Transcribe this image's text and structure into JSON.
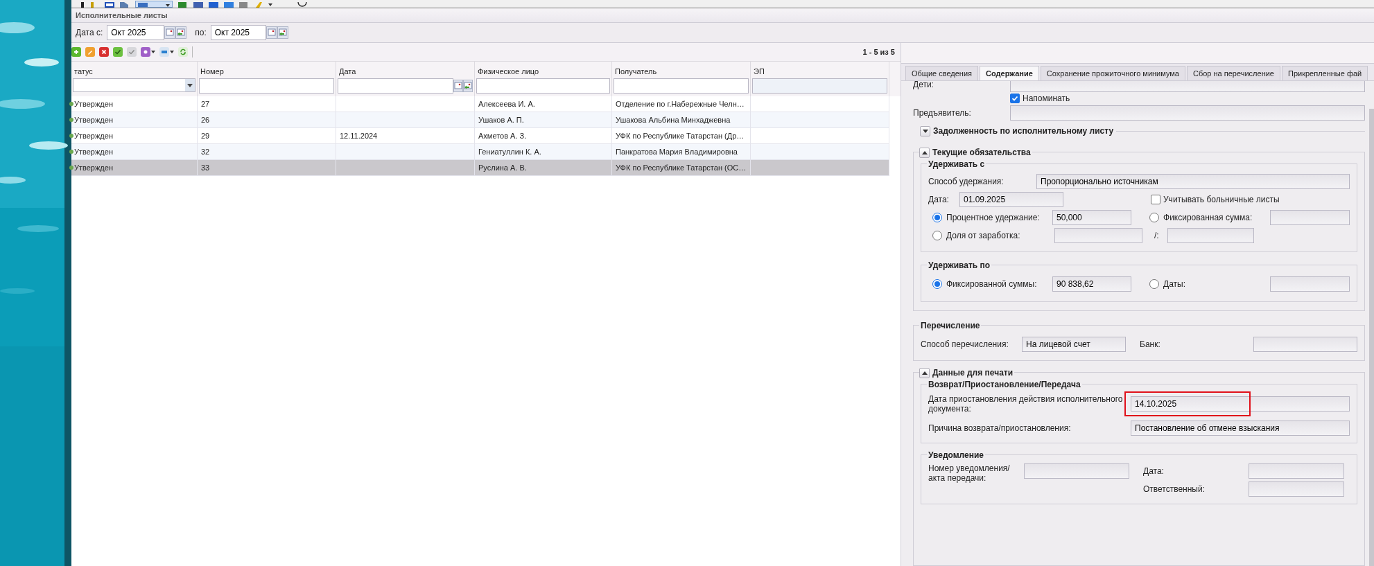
{
  "list_title": "Исполнительные листы",
  "date_filter": {
    "from_label": "Дата с:",
    "from_value": "Окт 2025",
    "to_label": "по:",
    "to_value": "Окт 2025"
  },
  "pager": "1 - 5 из 5",
  "table": {
    "columns": [
      "татус",
      "Номер",
      "Дата",
      "Физическое лицо",
      "Получатель",
      "ЭП"
    ],
    "rows": [
      {
        "cells": [
          "Утвержден",
          "27",
          "",
          "Алексеева И. А.",
          "Отделение по г.Набережные Челн…",
          ""
        ],
        "selected": false
      },
      {
        "cells": [
          "Утвержден",
          "26",
          "",
          "Ушаков А. П.",
          "Ушакова Альбина Минхаджевна",
          ""
        ],
        "selected": false
      },
      {
        "cells": [
          "Утвержден",
          "29",
          "12.11.2024",
          "Ахметов А. З.",
          "УФК по Республике Татарстан (Др…",
          ""
        ],
        "selected": false
      },
      {
        "cells": [
          "Утвержден",
          "32",
          "",
          "Гениатуллин К. А.",
          "Панкратова Мария Владимировна",
          ""
        ],
        "selected": false
      },
      {
        "cells": [
          "Утвержден",
          "33",
          "",
          "Руслина А. В.",
          "УФК по Республике Татарстан (ОС…",
          ""
        ],
        "selected": true
      }
    ]
  },
  "tabs": [
    {
      "label": "Общие сведения",
      "selected": false
    },
    {
      "label": "Содержание",
      "selected": true
    },
    {
      "label": "Сохранение прожиточного минимума",
      "selected": false
    },
    {
      "label": "Сбор на перечисление",
      "selected": false
    },
    {
      "label": "Прикрепленные фай",
      "selected": false
    }
  ],
  "form": {
    "children_label": "Дети:",
    "remind": {
      "label": "Напоминать",
      "checked": true
    },
    "claimant_label": "Предъявитель:",
    "debt_section": {
      "title": "Задолженность по исполнительному листу",
      "expanded": false
    },
    "current_section": {
      "title": "Текущие обязательства",
      "expanded": true,
      "hold_from": {
        "title": "Удерживать с",
        "method_label": "Способ удержания:",
        "method_value": "Пропорционально источникам",
        "date_label": "Дата:",
        "date_value": "01.09.2025",
        "sick_leave": {
          "label": "Учитывать больничные листы",
          "checked": false
        },
        "options": [
          {
            "label": "Процентное удержание:",
            "value": "50,000",
            "selected": true
          },
          {
            "label": "Фиксированная сумма:",
            "selected": false
          },
          {
            "label": "Доля от заработка:",
            "selected": false
          }
        ],
        "fraction_separator": "/:"
      },
      "hold_until": {
        "title": "Удерживать по",
        "options": [
          {
            "label": "Фиксированной суммы:",
            "value": "90 838,62",
            "selected": true
          },
          {
            "label": "Даты:",
            "selected": false
          }
        ]
      }
    },
    "transfer": {
      "title": "Перечисление",
      "method_label": "Способ перечисления:",
      "method_value": "На лицевой счет",
      "bank_label": "Банк:"
    },
    "print_section": {
      "title": "Данные для печати",
      "expanded": true,
      "return": {
        "title": "Возврат/Приостановление/Передача",
        "suspend_date_label": "Дата приостановления действия исполнительного документа:",
        "suspend_date_value": "14.10.2025",
        "highlighted": true,
        "reason_label": "Причина возврата/приостановления:",
        "reason_value": "Постановление об отмене взыскания"
      },
      "notice": {
        "title": "Уведомление",
        "number_label": "Номер уведомления/\nакта передачи:",
        "date_label": "Дата:",
        "responsible_label": "Ответственный:"
      }
    }
  }
}
